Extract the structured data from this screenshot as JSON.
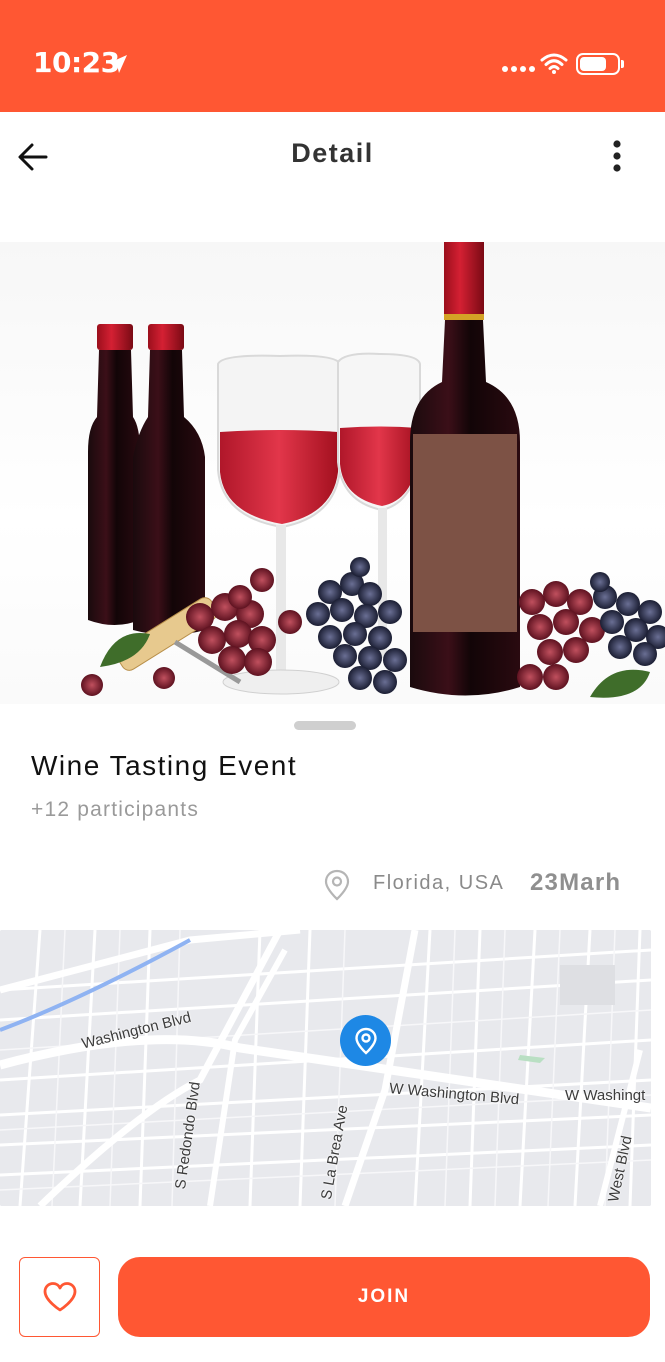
{
  "status_bar": {
    "time": "10:23",
    "color": "#FF5733"
  },
  "header": {
    "title": "Detail",
    "back_icon": "arrow-left-icon",
    "menu_icon": "more-vertical-icon"
  },
  "event": {
    "image_subject": "wine bottles, glasses of red wine and grapes",
    "title": "Wine Tasting Event",
    "participants": "+12 participants",
    "location": "Florida, USA",
    "date": "23Marh"
  },
  "map": {
    "labels": [
      "Washington Blvd",
      "W Washington Blvd",
      "W Washingt",
      "S Redondo Blvd",
      "S La Brea Ave",
      "West Blvd"
    ],
    "pin_color": "#1E88E5"
  },
  "actions": {
    "favorite_icon": "heart-icon",
    "join_label": "JOIN",
    "accent": "#FF5733"
  }
}
